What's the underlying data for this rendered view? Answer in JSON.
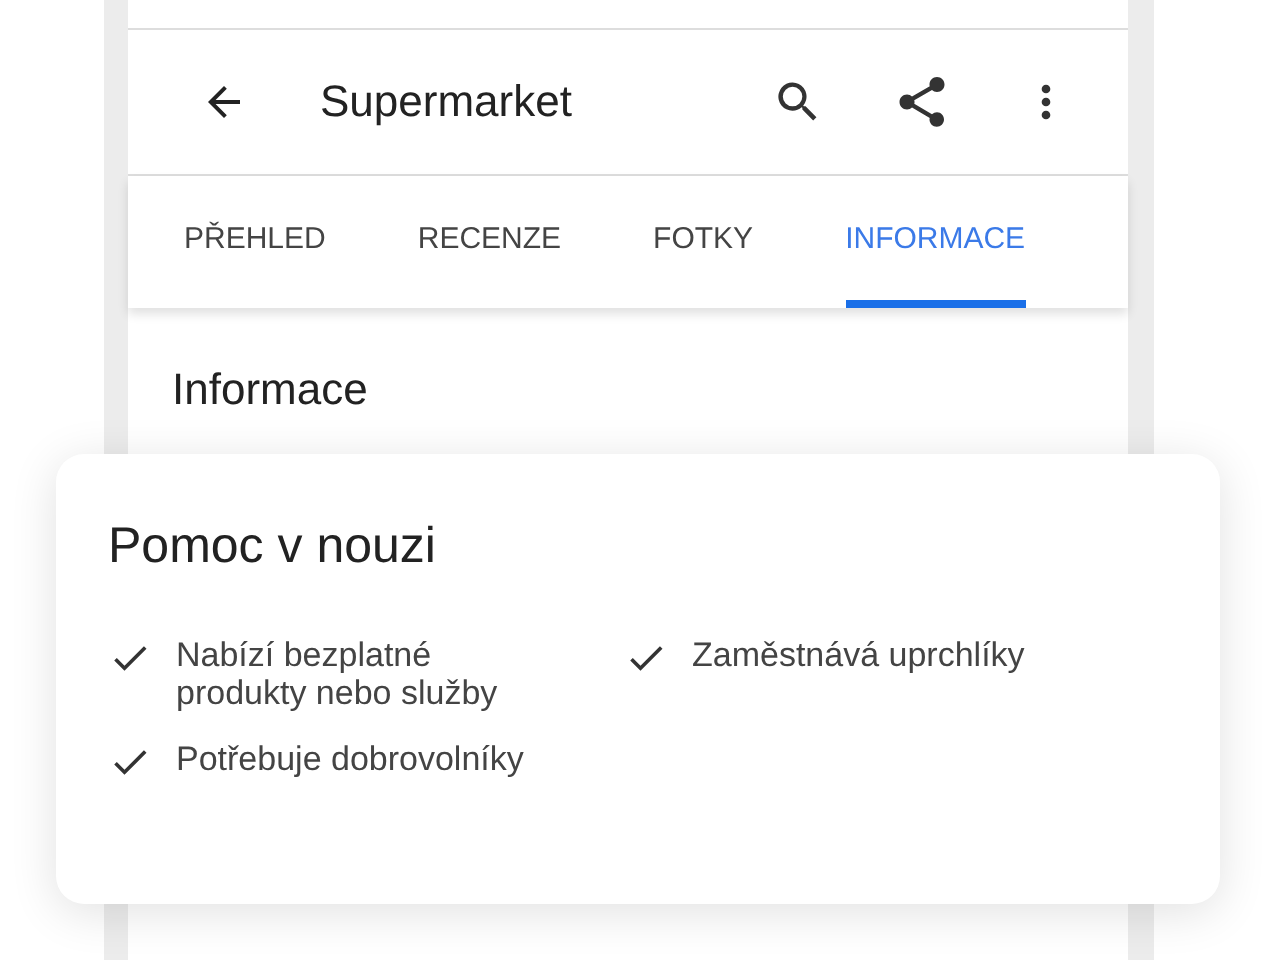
{
  "app_bar": {
    "title": "Supermarket"
  },
  "tabs": [
    {
      "label": "PŘEHLED",
      "selected": false
    },
    {
      "label": "RECENZE",
      "selected": false
    },
    {
      "label": "FOTKY",
      "selected": false
    },
    {
      "label": "INFORMACE",
      "selected": true
    }
  ],
  "section": {
    "heading": "Informace"
  },
  "card": {
    "title": "Pomoc v nouzi",
    "items": [
      {
        "text": "Nabízí bezplatné produkty nebo služby"
      },
      {
        "text": "Zaměstnává uprchlíky"
      },
      {
        "text": "Potřebuje dobrovolníky"
      }
    ]
  }
}
